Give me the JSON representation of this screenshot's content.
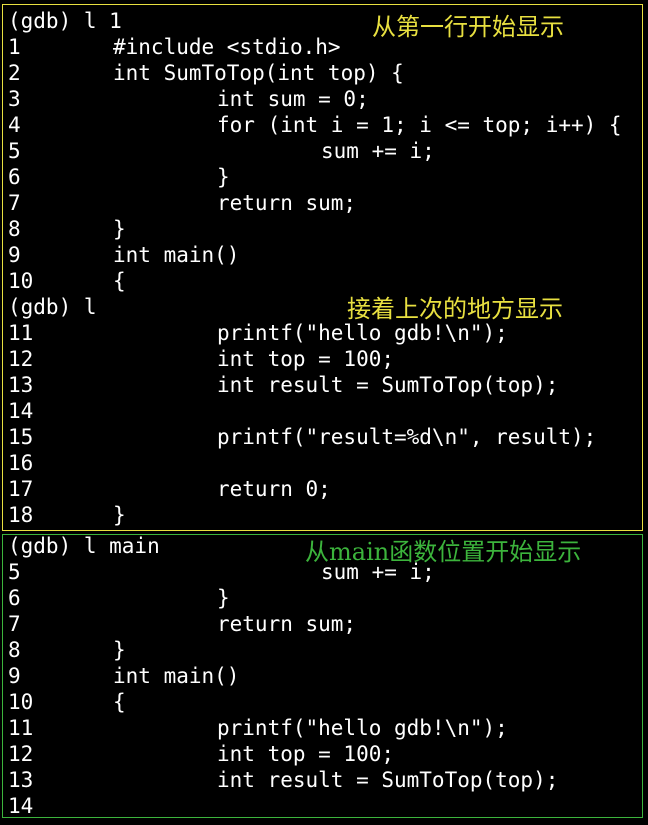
{
  "colors": {
    "background": "#000000",
    "text": "#ffffff",
    "panel1_border": "#e8e040",
    "panel2_border": "#3cb43c",
    "note1_color": "#e8e040",
    "note2_color": "#e8e040",
    "note3_color": "#3cb43c"
  },
  "panel1": {
    "cmd1": "(gdb) l 1",
    "note1": "从第一行开始显示",
    "lines1": [
      {
        "n": "1",
        "code": "#include <stdio.h>",
        "indent": 0
      },
      {
        "n": "2",
        "code": "int SumToTop(int top) {",
        "indent": 0
      },
      {
        "n": "3",
        "code": "int sum = 0;",
        "indent": 1
      },
      {
        "n": "4",
        "code": "for (int i = 1; i <= top; i++) {",
        "indent": 1
      },
      {
        "n": "5",
        "code": "sum += i;",
        "indent": 2
      },
      {
        "n": "6",
        "code": "}",
        "indent": 1
      },
      {
        "n": "7",
        "code": "return sum;",
        "indent": 1
      },
      {
        "n": "8",
        "code": "}",
        "indent": 0
      },
      {
        "n": "9",
        "code": "int main()",
        "indent": 0
      },
      {
        "n": "10",
        "code": "{",
        "indent": 0
      }
    ],
    "cmd2": "(gdb) l",
    "note2": "接着上次的地方显示",
    "lines2": [
      {
        "n": "11",
        "code": "printf(\"hello gdb!\\n\");",
        "indent": 1
      },
      {
        "n": "12",
        "code": "int top = 100;",
        "indent": 1
      },
      {
        "n": "13",
        "code": "int result = SumToTop(top);",
        "indent": 1
      },
      {
        "n": "14",
        "code": "",
        "indent": 0
      },
      {
        "n": "15",
        "code": "printf(\"result=%d\\n\", result);",
        "indent": 1
      },
      {
        "n": "16",
        "code": "",
        "indent": 0
      },
      {
        "n": "17",
        "code": "return 0;",
        "indent": 1
      },
      {
        "n": "18",
        "code": "}",
        "indent": 0
      }
    ]
  },
  "panel2": {
    "cmd3": "(gdb) l main",
    "note3": "从main函数位置开始显示",
    "lines3": [
      {
        "n": "5",
        "code": "sum += i;",
        "indent": 2
      },
      {
        "n": "6",
        "code": "}",
        "indent": 1
      },
      {
        "n": "7",
        "code": "return sum;",
        "indent": 1
      },
      {
        "n": "8",
        "code": "}",
        "indent": 0
      },
      {
        "n": "9",
        "code": "int main()",
        "indent": 0
      },
      {
        "n": "10",
        "code": "{",
        "indent": 0
      },
      {
        "n": "11",
        "code": "printf(\"hello gdb!\\n\");",
        "indent": 1
      },
      {
        "n": "12",
        "code": "int top = 100;",
        "indent": 1
      },
      {
        "n": "13",
        "code": "int result = SumToTop(top);",
        "indent": 1
      },
      {
        "n": "14",
        "code": "",
        "indent": 0
      }
    ]
  }
}
